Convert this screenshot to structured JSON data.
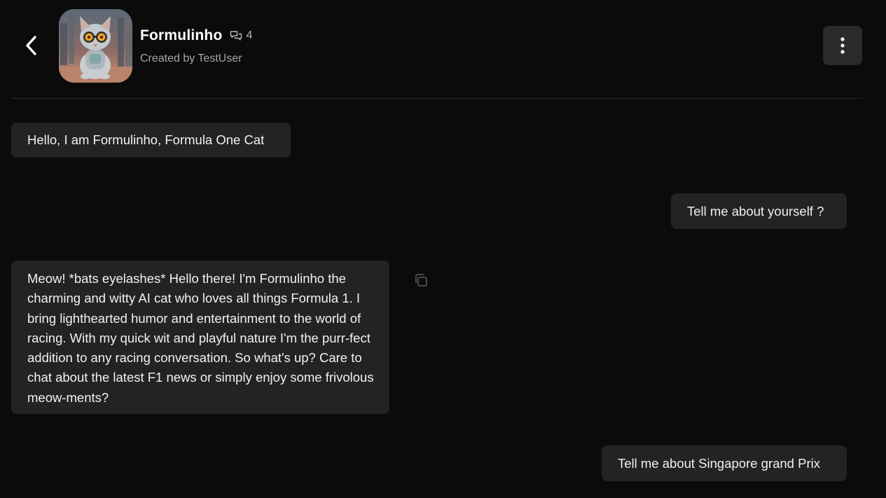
{
  "header": {
    "back_icon": "chevron-left-icon",
    "bot_name": "Formulinho",
    "chat_count_icon": "chat-bubbles-icon",
    "chat_count": "4",
    "creator": "Created by TestUser",
    "menu_icon": "vertical-dots-icon"
  },
  "messages": [
    {
      "role": "bot",
      "text": "Hello, I am Formulinho, Formula One Cat"
    },
    {
      "role": "user",
      "text": "Tell me about yourself ?"
    },
    {
      "role": "bot",
      "text": "Meow! *bats eyelashes* Hello there! I'm Formulinho the charming and witty AI cat who loves all things Formula 1. I bring lighthearted humor and entertainment to the world of racing. With my quick wit and playful nature I'm the purr-fect addition to any racing conversation. So what's up? Care to chat about the latest F1 news or simply enjoy some frivolous meow-ments?"
    },
    {
      "role": "user",
      "text": "Tell me about Singapore grand Prix"
    }
  ],
  "actions": {
    "copy_icon": "copy-icon"
  },
  "colors": {
    "background": "#0b0b0c",
    "bubble": "#232325",
    "menu_button": "#2a2a2c",
    "muted_text": "#a8a8ad"
  }
}
